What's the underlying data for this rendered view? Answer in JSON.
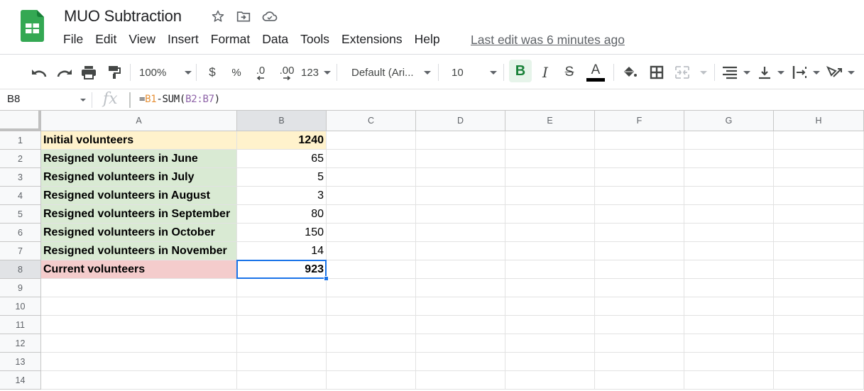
{
  "app": {
    "title": "MUO Subtraction",
    "last_edit": "Last edit was 6 minutes ago",
    "menu": [
      "File",
      "Edit",
      "View",
      "Insert",
      "Format",
      "Data",
      "Tools",
      "Extensions",
      "Help"
    ]
  },
  "toolbar": {
    "zoom": "100%",
    "currency": "$",
    "percent": "%",
    "decrease_decimal": ".0",
    "increase_decimal": ".00",
    "number_format": "123",
    "font": "Default (Ari...",
    "font_size": "10",
    "bold": "B",
    "italic": "I",
    "strikethrough": "S",
    "text_color_letter": "A",
    "text_color": "#000000"
  },
  "formula_bar": {
    "cell_ref": "B8",
    "fx": "fx",
    "formula_parts": [
      "=",
      "B1",
      "-SUM(",
      "B2:B7",
      ")"
    ]
  },
  "sheet": {
    "columns": [
      "A",
      "B",
      "C",
      "D",
      "E",
      "F",
      "G",
      "H"
    ],
    "row_numbers": [
      "1",
      "2",
      "3",
      "4",
      "5",
      "6",
      "7",
      "8",
      "9",
      "10",
      "11",
      "12",
      "13",
      "14"
    ],
    "selected_cell": "B8",
    "colors": {
      "initial_fill": "#fff2cc",
      "resigned_fill": "#d9ead3",
      "current_fill": "#f4cccc",
      "selection": "#1a73e8"
    },
    "rows": [
      {
        "label": "Initial volunteers",
        "value": "1240",
        "bold_value": true,
        "fill": "initial"
      },
      {
        "label": "Resigned volunteers in June",
        "value": "65",
        "bold_value": false,
        "fill": "resigned"
      },
      {
        "label": "Resigned volunteers in July",
        "value": "5",
        "bold_value": false,
        "fill": "resigned"
      },
      {
        "label": "Resigned volunteers in August",
        "value": "3",
        "bold_value": false,
        "fill": "resigned"
      },
      {
        "label": "Resigned volunteers in September",
        "value": "80",
        "bold_value": false,
        "fill": "resigned"
      },
      {
        "label": "Resigned volunteers in October",
        "value": "150",
        "bold_value": false,
        "fill": "resigned"
      },
      {
        "label": "Resigned volunteers in November",
        "value": "14",
        "bold_value": false,
        "fill": "resigned"
      },
      {
        "label": "Current volunteers",
        "value": "923",
        "bold_value": true,
        "fill": "current"
      }
    ]
  }
}
